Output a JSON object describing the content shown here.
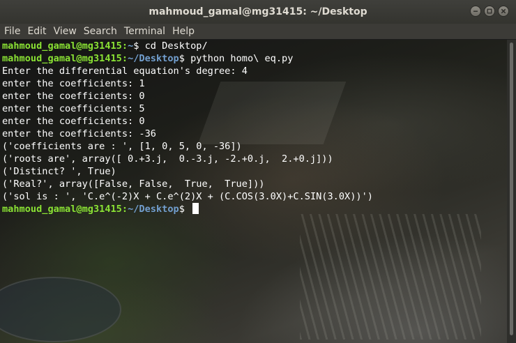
{
  "window": {
    "title": "mahmoud_gamal@mg31415: ~/Desktop",
    "buttons": [
      "minimize-icon",
      "maximize-icon",
      "close-icon"
    ]
  },
  "menu": [
    "File",
    "Edit",
    "View",
    "Search",
    "Terminal",
    "Help"
  ],
  "prompt": {
    "user_host": "mahmoud_gamal@mg31415",
    "colors": {
      "user": "#8ae234",
      "path": "#729fcf",
      "text": "#ffffff"
    }
  },
  "terminal": {
    "lines": [
      {
        "type": "prompt",
        "user": "mahmoud_gamal@mg31415",
        "sep": ":",
        "path": "~",
        "suffix": "$ cd Desktop/"
      },
      {
        "type": "prompt",
        "user": "mahmoud_gamal@mg31415",
        "sep": ":",
        "path": "~/Desktop",
        "suffix": "$ python homo\\ eq.py"
      },
      {
        "type": "output",
        "text": "Enter the differential equation's degree: 4"
      },
      {
        "type": "output",
        "text": "enter the coefficients: 1"
      },
      {
        "type": "output",
        "text": "enter the coefficients: 0"
      },
      {
        "type": "output",
        "text": "enter the coefficients: 5"
      },
      {
        "type": "output",
        "text": "enter the coefficients: 0"
      },
      {
        "type": "output",
        "text": "enter the coefficients: -36"
      },
      {
        "type": "output",
        "text": "('coefficients are : ', [1, 0, 5, 0, -36])"
      },
      {
        "type": "output",
        "text": "('roots are', array([ 0.+3.j,  0.-3.j, -2.+0.j,  2.+0.j]))"
      },
      {
        "type": "output",
        "text": "('Distinct? ', True)"
      },
      {
        "type": "output",
        "text": "('Real?', array([False, False,  True,  True]))"
      },
      {
        "type": "output",
        "text": "('sol is : ', 'C.e^(-2)X + C.e^(2)X + (C.COS(3.0X)+C.SIN(3.0X))')"
      },
      {
        "type": "prompt",
        "user": "mahmoud_gamal@mg31415",
        "sep": ":",
        "path": "~/Desktop",
        "suffix": "$ ",
        "cursor": true
      }
    ]
  }
}
